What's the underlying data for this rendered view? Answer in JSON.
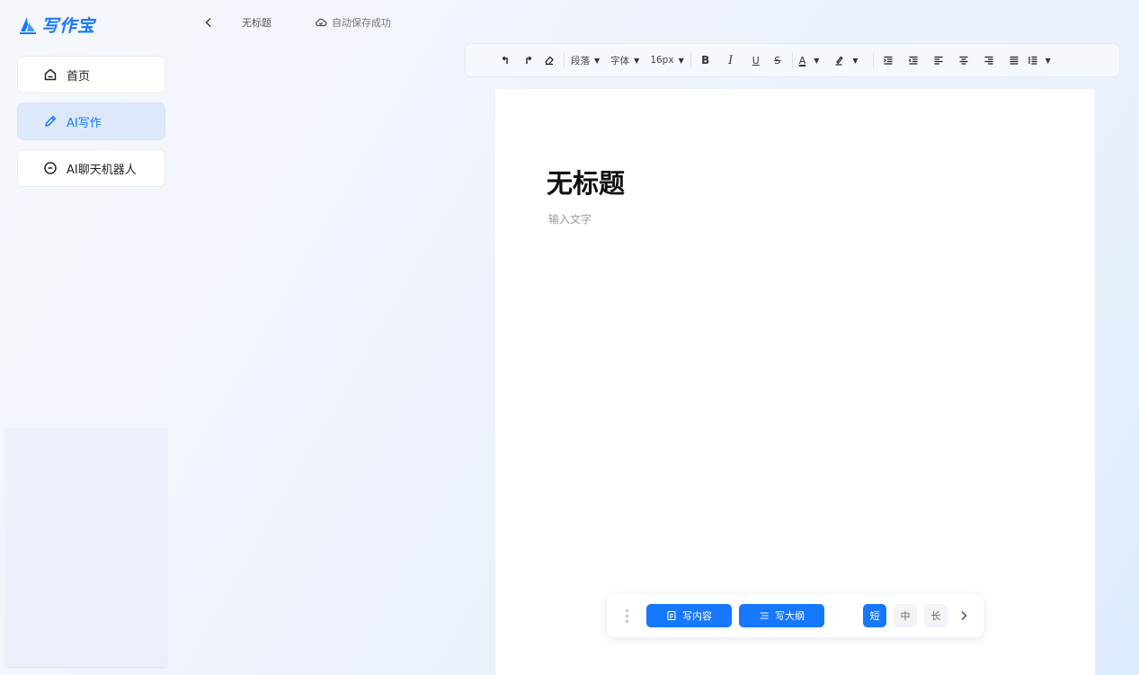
{
  "app": {
    "name": "写作宝",
    "brand_color": "#1677ff"
  },
  "sidebar": {
    "items": [
      {
        "label": "首页",
        "icon": "home-icon",
        "active": false
      },
      {
        "label": "AI写作",
        "icon": "pencil-icon",
        "active": true
      },
      {
        "label": "AI聊天机器人",
        "icon": "chat-icon",
        "active": false
      }
    ]
  },
  "topbar": {
    "back_icon": "chevron-left-icon",
    "document_title": "无标题",
    "save_status": "自动保存成功",
    "save_icon": "cloud-icon"
  },
  "toolbar": {
    "undo_icon": "undo-icon",
    "redo_icon": "redo-icon",
    "clear_format_icon": "eraser-icon",
    "paragraph_label": "段落",
    "font_label": "字体",
    "font_size": "16px",
    "bold_label": "B",
    "italic_label": "I",
    "underline_label": "U",
    "strike_label": "S",
    "font_color_label": "A",
    "highlight_icon": "highlighter-icon",
    "indent_icon": "indent-icon",
    "outdent_icon": "outdent-icon",
    "align_left_icon": "align-left-icon",
    "align_center_icon": "align-center-icon",
    "align_right_icon": "align-right-icon",
    "justify_icon": "justify-icon",
    "line_height_icon": "line-height-icon"
  },
  "editor": {
    "title": "无标题",
    "placeholder": "输入文字"
  },
  "ai_bar": {
    "write_content_label": "写内容",
    "write_outline_label": "写大纲",
    "lengths": [
      {
        "label": "短",
        "active": true
      },
      {
        "label": "中",
        "active": false
      },
      {
        "label": "长",
        "active": false
      }
    ],
    "more_icon": "chevron-right-icon"
  }
}
